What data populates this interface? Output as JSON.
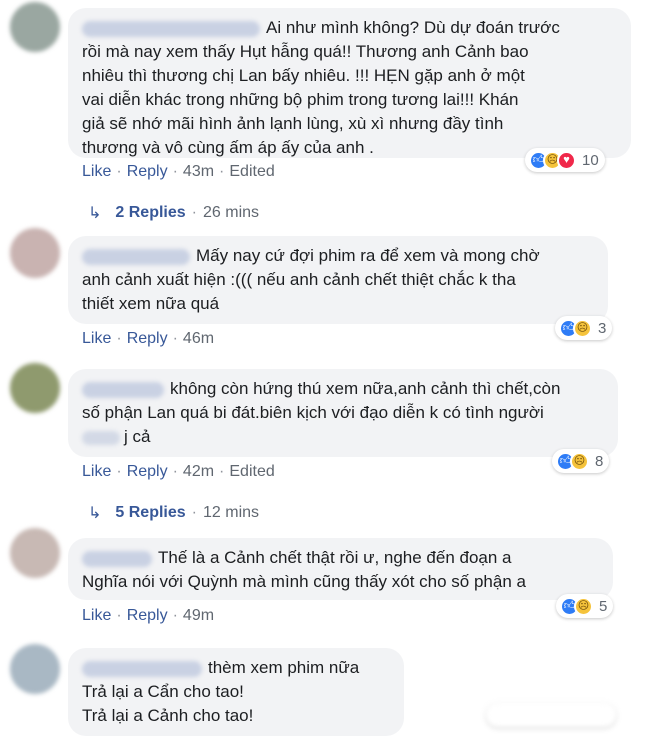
{
  "comments": [
    {
      "lines": [
        "Ai như mình không? Dù dự đoán trước",
        "rồi mà nay xem thấy Hụt hẫng quá!! Thương anh Cảnh bao",
        "nhiêu thì thương chị Lan bấy nhiêu. !!! HẸN gặp anh ở một",
        "vai diễn khác trong những bộ phim trong tương lai!!! Khán",
        "giả sẽ nhớ mãi hình ảnh lạnh lùng, xù xì nhưng đầy tình",
        "thương và vô cùng ấm áp ấy của anh ."
      ],
      "reactions": {
        "icons": [
          "like-icon",
          "sad-icon",
          "love-icon"
        ],
        "count": "10"
      },
      "actions": {
        "like": "Like",
        "reply": "Reply",
        "time": "43m",
        "edited": "Edited"
      },
      "replies": {
        "count": "2 Replies",
        "time": "26 mins"
      },
      "avatar_color": "#9aa7a1"
    },
    {
      "lines": [
        "Mấy nay cứ đợi phim ra để xem và mong chờ",
        "anh cảnh xuất hiện :((( nếu anh cảnh chết thiệt chắc k tha",
        "thiết xem nữa quá"
      ],
      "reactions": {
        "icons": [
          "like-icon",
          "sad-icon"
        ],
        "count": "3"
      },
      "actions": {
        "like": "Like",
        "reply": "Reply",
        "time": "46m"
      },
      "avatar_color": "#c9b3b1"
    },
    {
      "lines": [
        "không còn hứng thú xem nữa,anh cảnh thì chết,còn",
        "số phận Lan quá bi đát.biên kịch với đạo diễn k có tình người",
        "j cả"
      ],
      "reactions": {
        "icons": [
          "like-icon",
          "sad-icon"
        ],
        "count": "8"
      },
      "actions": {
        "like": "Like",
        "reply": "Reply",
        "time": "42m",
        "edited": "Edited"
      },
      "replies": {
        "count": "5 Replies",
        "time": "12 mins"
      },
      "avatar_color": "#8f9a6e"
    },
    {
      "lines": [
        "Thế là a Cảnh chết thật rồi ư, nghe đến đoạn a",
        "Nghĩa nói với Quỳnh mà mình cũng thấy xót cho số phận a"
      ],
      "reactions": {
        "icons": [
          "like-icon",
          "sad-icon"
        ],
        "count": "5"
      },
      "actions": {
        "like": "Like",
        "reply": "Reply",
        "time": "49m"
      },
      "avatar_color": "#c8b9b4"
    },
    {
      "lines": [
        "thèm xem phim nữa",
        "Trả lại a Cẩn cho tao!",
        "Trả lại a Cảnh cho tao!"
      ],
      "reactions": {
        "icons": [],
        "count": ""
      },
      "avatar_color": "#a9b8c4"
    }
  ],
  "colors": {
    "link": "#385898",
    "meta": "#606770",
    "bubble": "#f2f3f5",
    "like": "#2e7cf6",
    "sad": "#f5c33b",
    "love": "#f0284a"
  }
}
